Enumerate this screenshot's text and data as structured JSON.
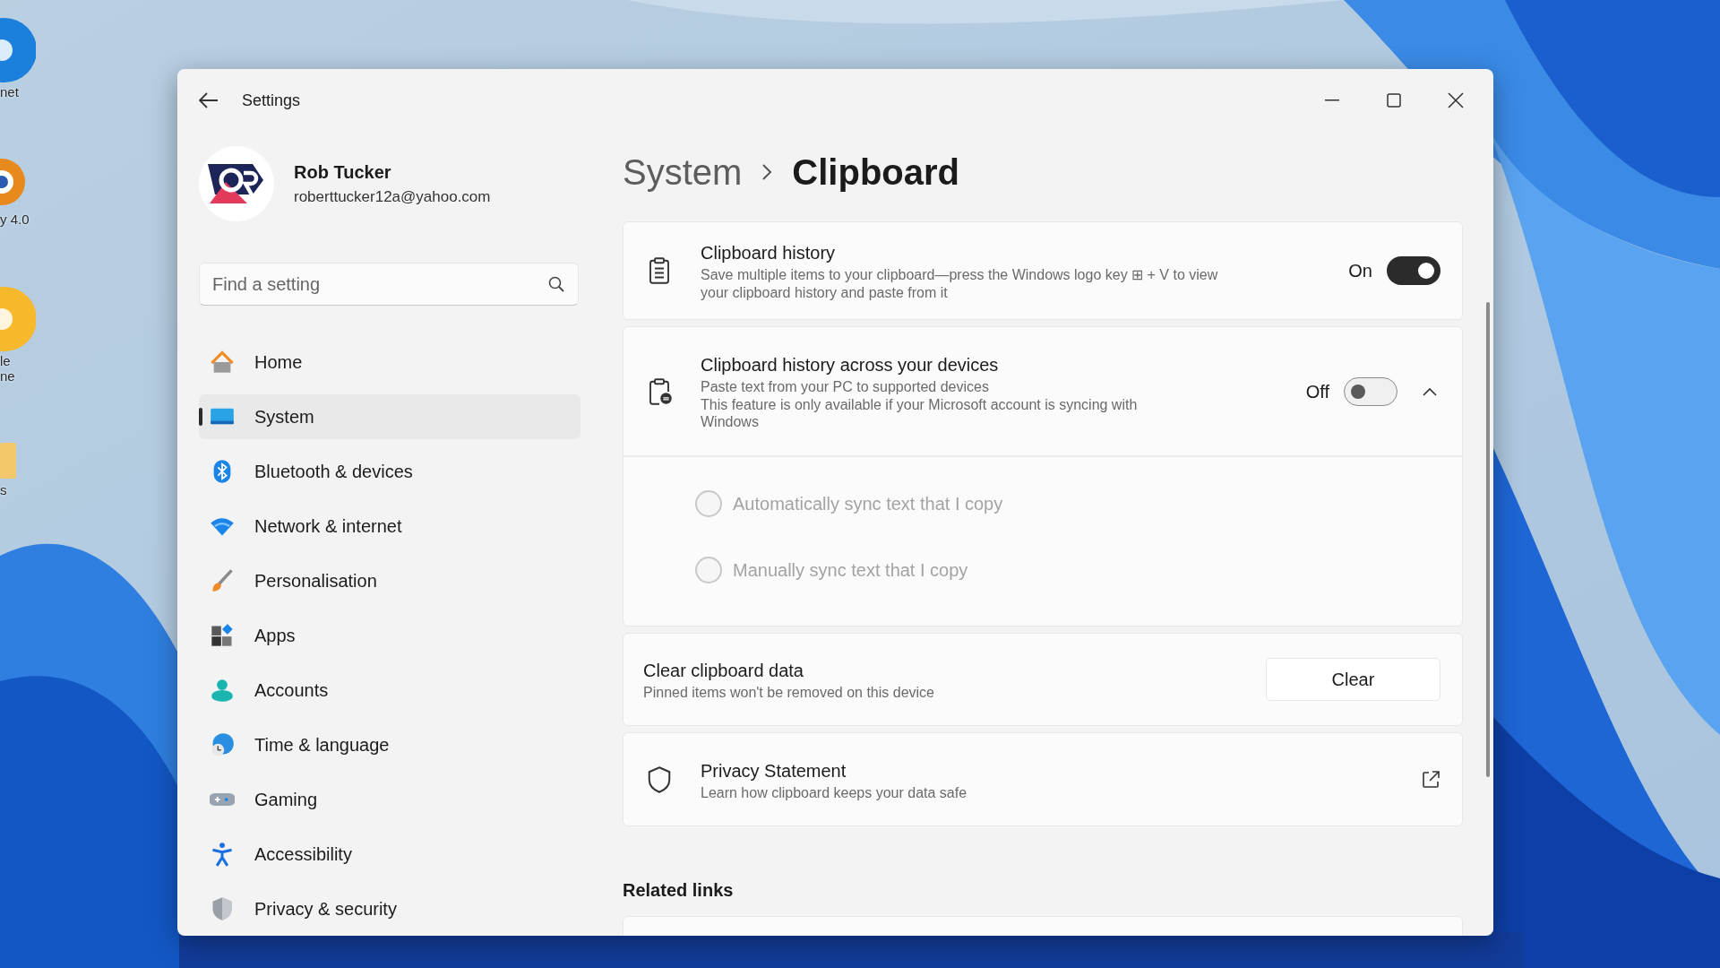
{
  "desktop_icons": [
    {
      "kind": "round",
      "color": "#1b7fdc",
      "lines": [
        "net"
      ]
    },
    {
      "kind": "ring",
      "color": "#e8891d",
      "lines": [
        "y 4.0"
      ]
    },
    {
      "kind": "round",
      "color": "#f6b92b",
      "lines": [
        "le",
        "ne"
      ]
    },
    {
      "kind": "folder",
      "color": "#f2c86a",
      "lines": [
        "s"
      ]
    }
  ],
  "window": {
    "title": "Settings"
  },
  "profile": {
    "name": "Rob Tucker",
    "email": "roberttucker12a@yahoo.com"
  },
  "search": {
    "placeholder": "Find a setting"
  },
  "nav": [
    {
      "label": "Home",
      "selected": false
    },
    {
      "label": "System",
      "selected": true
    },
    {
      "label": "Bluetooth & devices",
      "selected": false
    },
    {
      "label": "Network & internet",
      "selected": false
    },
    {
      "label": "Personalisation",
      "selected": false
    },
    {
      "label": "Apps",
      "selected": false
    },
    {
      "label": "Accounts",
      "selected": false
    },
    {
      "label": "Time & language",
      "selected": false
    },
    {
      "label": "Gaming",
      "selected": false
    },
    {
      "label": "Accessibility",
      "selected": false
    },
    {
      "label": "Privacy & security",
      "selected": false
    }
  ],
  "breadcrumb": [
    "System",
    "Clipboard"
  ],
  "cards": [
    {
      "kind": "toggle",
      "title": "Clipboard history",
      "lines": [
        "Save multiple items to your clipboard—press the Windows logo key ⊞ + V to view your clipboard history and paste from it"
      ],
      "state_text": "On",
      "on": true
    },
    {
      "kind": "expander",
      "title": "Clipboard history across your devices",
      "lines": [
        "Paste text from your PC to supported devices",
        "This feature is only available if your Microsoft account is syncing with Windows"
      ],
      "state_text": "Off",
      "on": false,
      "expanded": true,
      "options": [
        {
          "label": "Automatically sync text that I copy",
          "selected": false,
          "disabled": true
        },
        {
          "label": "Manually sync text that I copy",
          "selected": false,
          "disabled": true
        }
      ]
    },
    {
      "kind": "button",
      "title": "Clear clipboard data",
      "lines": [
        "Pinned items won't be removed on this device"
      ],
      "button": "Clear"
    },
    {
      "kind": "link",
      "title": "Privacy Statement",
      "lines": [
        "Learn how clipboard keeps your data safe"
      ]
    }
  ],
  "related_links": {
    "heading": "Related links"
  }
}
